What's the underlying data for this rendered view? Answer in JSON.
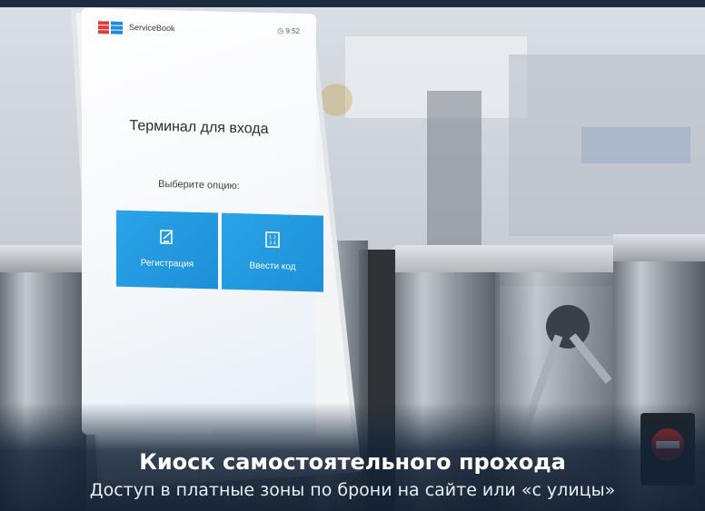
{
  "kiosk": {
    "brand": "ServiceBook",
    "time": "9:52",
    "title": "Терминал для входа",
    "prompt": "Выберите опцию:",
    "buttons": [
      {
        "label": "Регистрация",
        "icon": "edit-form-icon"
      },
      {
        "label": "Ввести код",
        "icon": "keypad-icon"
      }
    ]
  },
  "caption": {
    "title": "Киоск самостоятельного прохода",
    "subtitle": "Доступ в платные зоны по брони на сайте или «с улицы»"
  },
  "colors": {
    "accent": "#1d8fd8",
    "logo_red": "#e53935",
    "logo_blue": "#1e88e5",
    "caption_bg": "#14233a"
  }
}
